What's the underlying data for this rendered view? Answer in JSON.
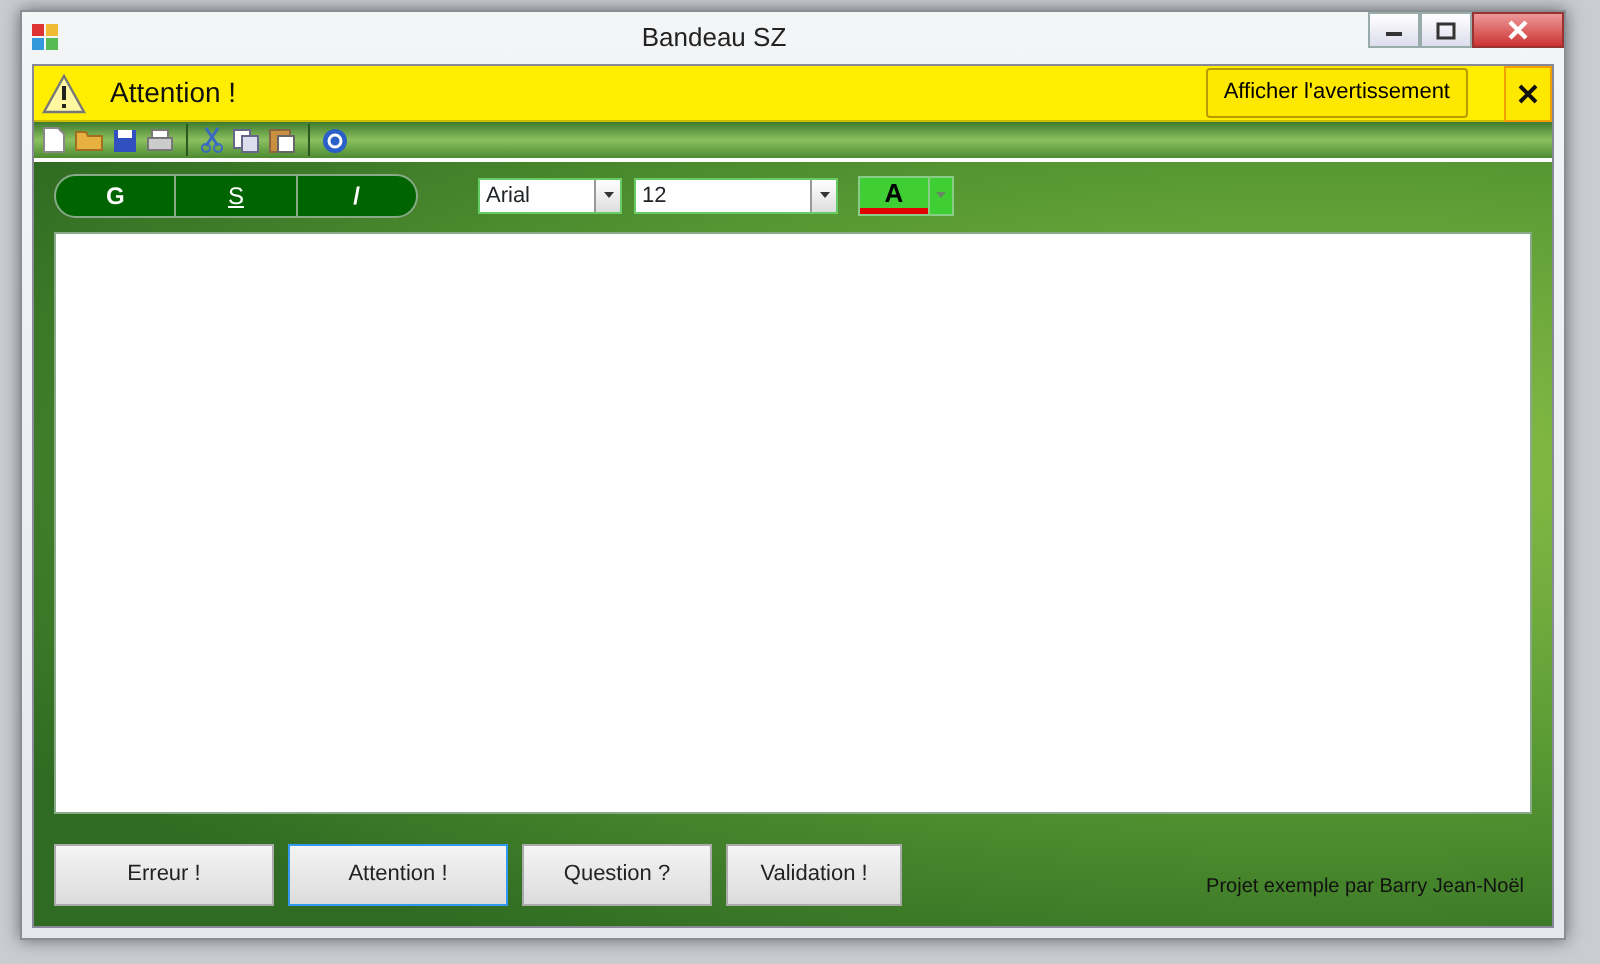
{
  "window": {
    "title": "Bandeau SZ"
  },
  "banner": {
    "message": "Attention !",
    "action": "Afficher l'avertissement"
  },
  "format_buttons": [
    {
      "label": "G",
      "kind": "bold"
    },
    {
      "label": "S",
      "kind": "underline"
    },
    {
      "label": "/",
      "kind": "italic"
    }
  ],
  "font_combo": {
    "value": "Arial"
  },
  "size_combo": {
    "value": "12"
  },
  "color_button": {
    "label": "A",
    "color": "#e00000"
  },
  "buttons": [
    {
      "label": "Erreur !",
      "focused": false
    },
    {
      "label": "Attention !",
      "focused": true
    },
    {
      "label": "Question ?",
      "focused": false
    },
    {
      "label": "Validation !",
      "focused": false
    }
  ],
  "credit": "Projet exemple par Barry Jean-Noël"
}
